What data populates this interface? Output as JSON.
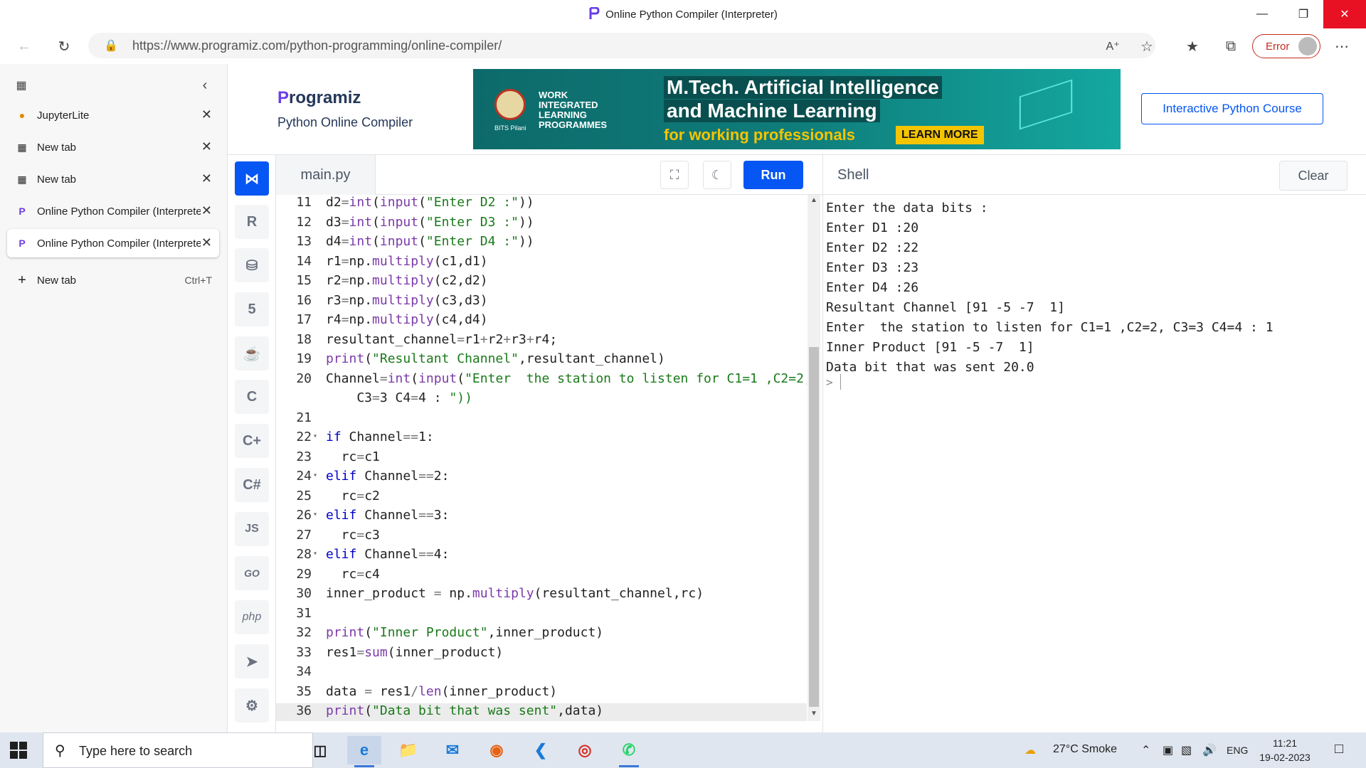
{
  "window": {
    "title": "Online Python Compiler (Interpreter)"
  },
  "browser": {
    "url": "https://www.programiz.com/python-programming/online-compiler/",
    "profile_status": "Error"
  },
  "tabs": [
    {
      "label": "JupyterLite",
      "icon": "jupyter-icon"
    },
    {
      "label": "New tab",
      "icon": "newtab-icon"
    },
    {
      "label": "New tab",
      "icon": "newtab-icon"
    },
    {
      "label": "Online Python Compiler (Interpreter)",
      "icon": "programiz-icon"
    },
    {
      "label": "Online Python Compiler (Interpreter)",
      "icon": "programiz-icon",
      "active": true
    }
  ],
  "new_tab": {
    "label": "New tab",
    "shortcut": "Ctrl+T"
  },
  "site": {
    "logo": "rogramiz",
    "logo_p": "P",
    "subtitle": "Python Online Compiler",
    "course_button": "Interactive Python Course"
  },
  "banner": {
    "seal_text": "BITS Pilani",
    "program": "WORK INTEGRATED LEARNING PROGRAMMES",
    "line1": "M.Tech. Artificial Intelligence",
    "line2": "and Machine Learning",
    "line3": "for working professionals",
    "cta": "LEARN MORE"
  },
  "languages": [
    "python",
    "r",
    "sql",
    "html",
    "java",
    "c",
    "cpp",
    "csharp",
    "JS",
    "GO",
    "php",
    "swift",
    "rust"
  ],
  "editor": {
    "file_name": "main.py",
    "run_label": "Run",
    "lines": [
      {
        "n": "11",
        "text": "d2=int(input(\"Enter D2 :\"))"
      },
      {
        "n": "12",
        "text": "d3=int(input(\"Enter D3 :\"))"
      },
      {
        "n": "13",
        "text": "d4=int(input(\"Enter D4 :\"))"
      },
      {
        "n": "14",
        "text": "r1=np.multiply(c1,d1)"
      },
      {
        "n": "15",
        "text": "r2=np.multiply(c2,d2)"
      },
      {
        "n": "16",
        "text": "r3=np.multiply(c3,d3)"
      },
      {
        "n": "17",
        "text": "r4=np.multiply(c4,d4)"
      },
      {
        "n": "18",
        "text": "resultant_channel=r1+r2+r3+r4;"
      },
      {
        "n": "19",
        "text": "print(\"Resultant Channel\",resultant_channel)"
      },
      {
        "n": "20",
        "text": "Channel=int(input(\"Enter  the station to listen for C1=1 ,C2=2,"
      },
      {
        "n": "",
        "text": "    C3=3 C4=4 : \"))"
      },
      {
        "n": "21",
        "text": ""
      },
      {
        "n": "22",
        "text": "if Channel==1:",
        "fold": true
      },
      {
        "n": "23",
        "text": "  rc=c1"
      },
      {
        "n": "24",
        "text": "elif Channel==2:",
        "fold": true
      },
      {
        "n": "25",
        "text": "  rc=c2"
      },
      {
        "n": "26",
        "text": "elif Channel==3:",
        "fold": true
      },
      {
        "n": "27",
        "text": "  rc=c3"
      },
      {
        "n": "28",
        "text": "elif Channel==4:",
        "fold": true
      },
      {
        "n": "29",
        "text": "  rc=c4"
      },
      {
        "n": "30",
        "text": "inner_product = np.multiply(resultant_channel,rc)"
      },
      {
        "n": "31",
        "text": ""
      },
      {
        "n": "32",
        "text": "print(\"Inner Product\",inner_product)"
      },
      {
        "n": "33",
        "text": "res1=sum(inner_product)"
      },
      {
        "n": "34",
        "text": ""
      },
      {
        "n": "35",
        "text": "data = res1/len(inner_product)"
      },
      {
        "n": "36",
        "text": "print(\"Data bit that was sent\",data)",
        "current": true
      }
    ]
  },
  "shell": {
    "title": "Shell",
    "clear_label": "Clear",
    "prompt": ">",
    "output": [
      "Enter the data bits :",
      "Enter D1 :20",
      "Enter D2 :22",
      "Enter D3 :23",
      "Enter D4 :26",
      "Resultant Channel [91 -5 -7  1]",
      "Enter  the station to listen for C1=1 ,C2=2, C3=3 C4=4 : 1",
      "Inner Product [91 -5 -7  1]",
      "Data bit that was sent 20.0"
    ]
  },
  "taskbar": {
    "search_placeholder": "Type here to search",
    "weather": "27°C  Smoke",
    "lang": "ENG",
    "time": "11:21",
    "date": "19-02-2023"
  }
}
